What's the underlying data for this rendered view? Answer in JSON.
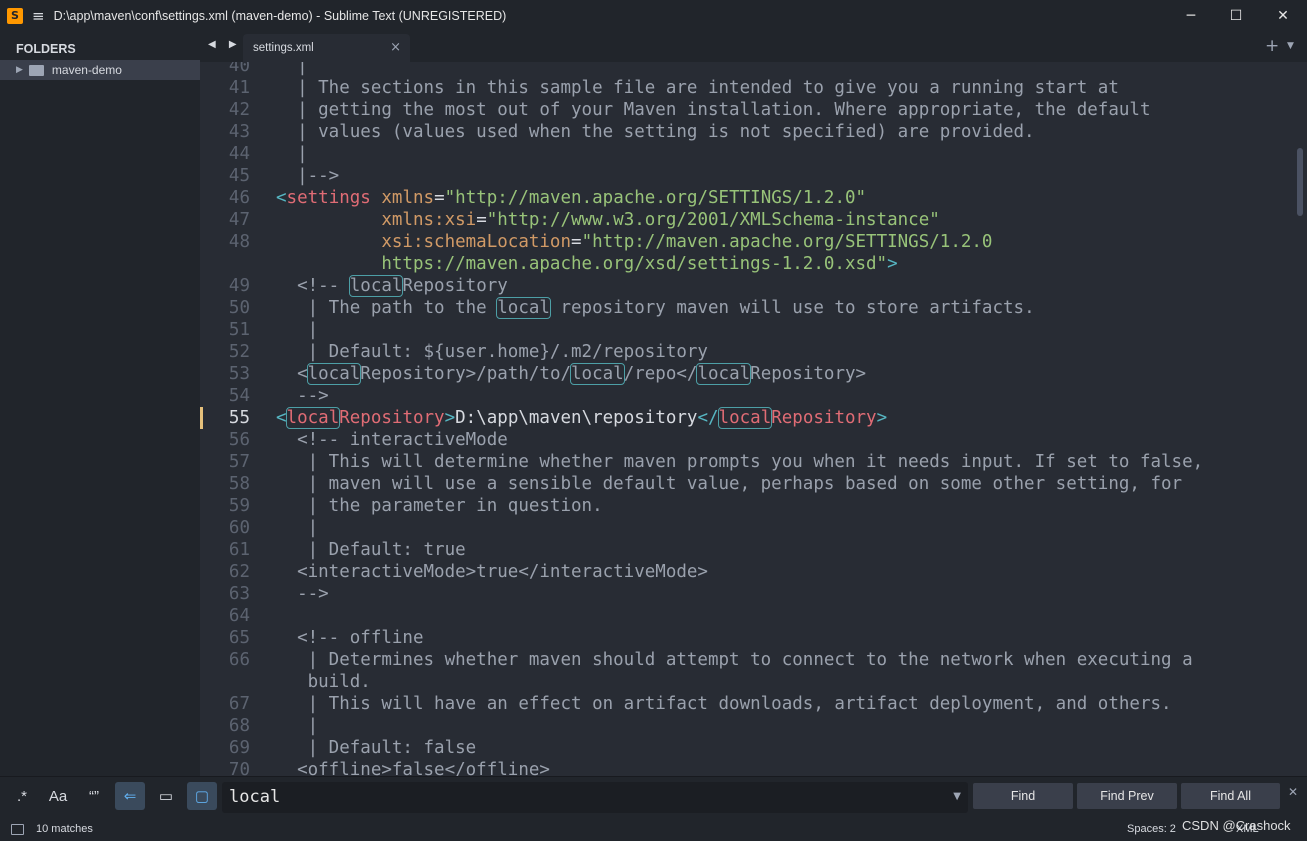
{
  "window": {
    "title": "D:\\app\\maven\\conf\\settings.xml (maven-demo) - Sublime Text (UNREGISTERED)",
    "app_icon": "sublime-text-icon",
    "menu_icon": "hamburger-menu-icon",
    "minimize": "─",
    "maximize": "☐",
    "close": "✕"
  },
  "sidebar": {
    "header": "FOLDERS",
    "folders": [
      {
        "name": "maven-demo",
        "expanded": false
      }
    ]
  },
  "tabs": {
    "nav": "◀ ▶",
    "items": [
      {
        "label": "settings.xml",
        "active": true,
        "close": "×"
      }
    ],
    "new_tab": "+",
    "dropdown": "▼"
  },
  "editor": {
    "current_line": 55,
    "search_highlight": "local",
    "lines": [
      {
        "n": "40",
        "segments": [
          [
            "c",
            "  |"
          ]
        ]
      },
      {
        "n": "41",
        "segments": [
          [
            "c",
            "  | The sections in this sample file are intended to give you a running start at"
          ]
        ]
      },
      {
        "n": "42",
        "segments": [
          [
            "c",
            "  | getting the most out of your Maven installation. Where appropriate, the default"
          ]
        ]
      },
      {
        "n": "43",
        "segments": [
          [
            "c",
            "  | values (values used when the setting is not specified) are provided."
          ]
        ]
      },
      {
        "n": "44",
        "segments": [
          [
            "c",
            "  |"
          ]
        ]
      },
      {
        "n": "45",
        "segments": [
          [
            "c",
            "  |-->"
          ]
        ]
      },
      {
        "n": "46",
        "segments": [
          [
            "p",
            "<"
          ],
          [
            "t",
            "settings"
          ],
          [
            "b",
            " "
          ],
          [
            "a",
            "xmlns"
          ],
          [
            "b",
            "="
          ],
          [
            "s",
            "\"http://maven.apache.org/SETTINGS/1.2.0\""
          ]
        ]
      },
      {
        "n": "47",
        "segments": [
          [
            "b",
            "          "
          ],
          [
            "a",
            "xmlns:xsi"
          ],
          [
            "b",
            "="
          ],
          [
            "s",
            "\"http://www.w3.org/2001/XMLSchema-instance\""
          ]
        ]
      },
      {
        "n": "48",
        "segments": [
          [
            "b",
            "          "
          ],
          [
            "a",
            "xsi:schemaLocation"
          ],
          [
            "b",
            "="
          ],
          [
            "s",
            "\"http://maven.apache.org/SETTINGS/1.2.0"
          ]
        ]
      },
      {
        "n": "",
        "segments": [
          [
            "s",
            "          https://maven.apache.org/xsd/settings-1.2.0.xsd\""
          ],
          [
            "p",
            ">"
          ]
        ]
      },
      {
        "n": "49",
        "segments": [
          [
            "c",
            "  <!-- "
          ],
          [
            "hc",
            "local"
          ],
          [
            "c",
            "Repository"
          ]
        ]
      },
      {
        "n": "50",
        "segments": [
          [
            "c",
            "   | The path to the "
          ],
          [
            "hc",
            "local"
          ],
          [
            "c",
            " repository maven will use to store artifacts."
          ]
        ]
      },
      {
        "n": "51",
        "segments": [
          [
            "c",
            "   |"
          ]
        ]
      },
      {
        "n": "52",
        "segments": [
          [
            "c",
            "   | Default: ${user.home}/.m2/repository"
          ]
        ]
      },
      {
        "n": "53",
        "segments": [
          [
            "c",
            "  <"
          ],
          [
            "hc",
            "local"
          ],
          [
            "c",
            "Repository>/path/to/"
          ],
          [
            "hc",
            "local"
          ],
          [
            "c",
            "/repo</"
          ],
          [
            "hc",
            "local"
          ],
          [
            "c",
            "Repository>"
          ]
        ]
      },
      {
        "n": "54",
        "segments": [
          [
            "c",
            "  -->"
          ]
        ]
      },
      {
        "n": "55",
        "segments": [
          [
            "p",
            "<"
          ],
          [
            "ht",
            "local"
          ],
          [
            "t",
            "Repository"
          ],
          [
            "p",
            ">"
          ],
          [
            "b",
            "D:\\app\\maven\\repository"
          ],
          [
            "p",
            "</"
          ],
          [
            "ht",
            "local"
          ],
          [
            "t",
            "Repository"
          ],
          [
            "p",
            ">"
          ]
        ]
      },
      {
        "n": "56",
        "segments": [
          [
            "c",
            "  <!-- interactiveMode"
          ]
        ]
      },
      {
        "n": "57",
        "segments": [
          [
            "c",
            "   | This will determine whether maven prompts you when it needs input. If set to false,"
          ]
        ]
      },
      {
        "n": "58",
        "segments": [
          [
            "c",
            "   | maven will use a sensible default value, perhaps based on some other setting, for"
          ]
        ]
      },
      {
        "n": "59",
        "segments": [
          [
            "c",
            "   | the parameter in question."
          ]
        ]
      },
      {
        "n": "60",
        "segments": [
          [
            "c",
            "   |"
          ]
        ]
      },
      {
        "n": "61",
        "segments": [
          [
            "c",
            "   | Default: true"
          ]
        ]
      },
      {
        "n": "62",
        "segments": [
          [
            "c",
            "  <interactiveMode>true</interactiveMode>"
          ]
        ]
      },
      {
        "n": "63",
        "segments": [
          [
            "c",
            "  -->"
          ]
        ]
      },
      {
        "n": "64",
        "segments": [
          [
            "c",
            ""
          ]
        ]
      },
      {
        "n": "65",
        "segments": [
          [
            "c",
            "  <!-- offline"
          ]
        ]
      },
      {
        "n": "66",
        "segments": [
          [
            "c",
            "   | Determines whether maven should attempt to connect to the network when executing a"
          ]
        ]
      },
      {
        "n": "",
        "segments": [
          [
            "c",
            "   build."
          ]
        ]
      },
      {
        "n": "67",
        "segments": [
          [
            "c",
            "   | This will have an effect on artifact downloads, artifact deployment, and others."
          ]
        ]
      },
      {
        "n": "68",
        "segments": [
          [
            "c",
            "   |"
          ]
        ]
      },
      {
        "n": "69",
        "segments": [
          [
            "c",
            "   | Default: false"
          ]
        ]
      },
      {
        "n": "70",
        "segments": [
          [
            "c",
            "  <offline>false</offline>"
          ]
        ]
      }
    ]
  },
  "find": {
    "options": [
      {
        "label": ".*",
        "name": "regex-toggle",
        "on": false
      },
      {
        "label": "Aa",
        "name": "case-sensitive-toggle",
        "on": false
      },
      {
        "label": "“”",
        "name": "whole-word-toggle",
        "on": false
      },
      {
        "label": "⇐",
        "name": "wrap-toggle",
        "on": true
      },
      {
        "label": "▭",
        "name": "in-selection-toggle",
        "on": false
      },
      {
        "label": "▢",
        "name": "highlight-matches-toggle",
        "on": true
      }
    ],
    "query": "local",
    "history_icon": "▼",
    "find_label": "Find",
    "find_prev_label": "Find Prev",
    "find_all_label": "Find All",
    "close": "✕"
  },
  "status": {
    "matches": "10 matches",
    "spaces": "Spaces: 2",
    "syntax": "XML",
    "watermark": "CSDN @Crashock"
  },
  "colors": {
    "background": "#282c34",
    "sidebar": "#21252b",
    "comment": "#9aa1ad",
    "tag": "#e06c75",
    "attribute": "#d19a66",
    "string": "#98c379",
    "punctuation": "#56b6c2",
    "match_outline": "#4d9fa6",
    "current_line_marker": "#e5c07b"
  }
}
